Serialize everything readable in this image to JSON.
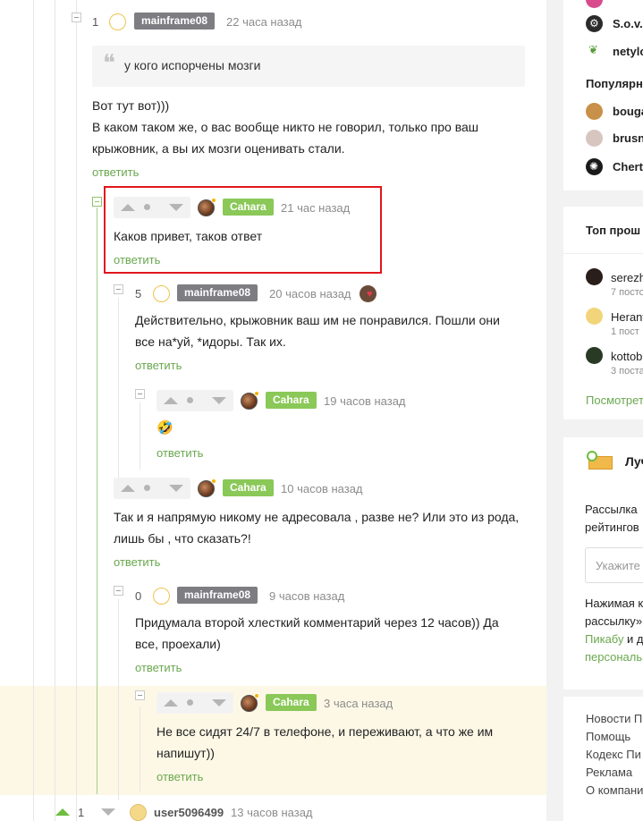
{
  "comments": [
    {
      "rating": "1",
      "user": "mainframe08",
      "time": "22 часа назад",
      "quote": "у кого испорчены мозги",
      "text_lines": [
        "Вот тут вот)))",
        "В каком таком же, о вас вообще никто не говорил, только про ваш",
        "крыжовник, а вы их мозги оценивать стали."
      ],
      "reply": "ответить"
    },
    {
      "user": "Cahara",
      "time": "21 час назад",
      "text_lines": [
        "Каков привет, таков ответ"
      ],
      "reply": "ответить"
    },
    {
      "rating": "5",
      "user": "mainframe08",
      "time": "20 часов назад",
      "text_lines": [
        "Действительно, крыжовник ваш им не понравился. Пошли они",
        "все на*уй, *идоры. Так их."
      ],
      "reply": "ответить"
    },
    {
      "user": "Cahara",
      "time": "19 часов назад",
      "emoji": "🤣",
      "reply": "ответить"
    },
    {
      "user": "Cahara",
      "time": "10 часов назад",
      "text_lines": [
        "Так и я напрямую никому не адресовала , разве не? Или это из рода,",
        "лишь бы , что сказать?!"
      ],
      "reply": "ответить"
    },
    {
      "rating": "0",
      "user": "mainframe08",
      "time": "9 часов назад",
      "text_lines": [
        "Придумала второй хлесткий комментарий через 12 часов)) Да",
        "все, проехали)"
      ],
      "reply": "ответить"
    },
    {
      "user": "Cahara",
      "time": "3 часа назад",
      "text_lines": [
        "Не все сидят 24/7 в телефоне, и переживают, а что же им",
        "напишут))"
      ],
      "reply": "ответить"
    },
    {
      "rating": "1",
      "user": "user5096499",
      "time": "13 часов назад"
    }
  ],
  "sidebar": {
    "users_top": [
      "S.o.v.",
      "netylo"
    ],
    "popular_title": "Популярн",
    "popular": [
      "bouga",
      "brusn",
      "Cherte"
    ],
    "top_title": "Топ прош",
    "top": [
      {
        "name": "serezh",
        "sub": "7 постов"
      },
      {
        "name": "Herant",
        "sub": "1 пост"
      },
      {
        "name": "kottob",
        "sub": "3 поста"
      }
    ],
    "see_more": "Посмотрет",
    "newsletter_title": "Луч",
    "newsletter_text": [
      "Рассылка",
      "рейтингов"
    ],
    "email_placeholder": "Укажите",
    "consent_lines": [
      "Нажимая к",
      "рассылку»",
      "Пикабу",
      "и д",
      "персональ"
    ],
    "footer_links": [
      "Новости П",
      "Помощь",
      "Кодекс Пи",
      "Реклама",
      "О компани"
    ]
  },
  "colors": {
    "accent_green": "#8ac858",
    "link_green": "#6aa84f",
    "highlight": "#fdf8e6",
    "red_box": "#e0171c"
  }
}
